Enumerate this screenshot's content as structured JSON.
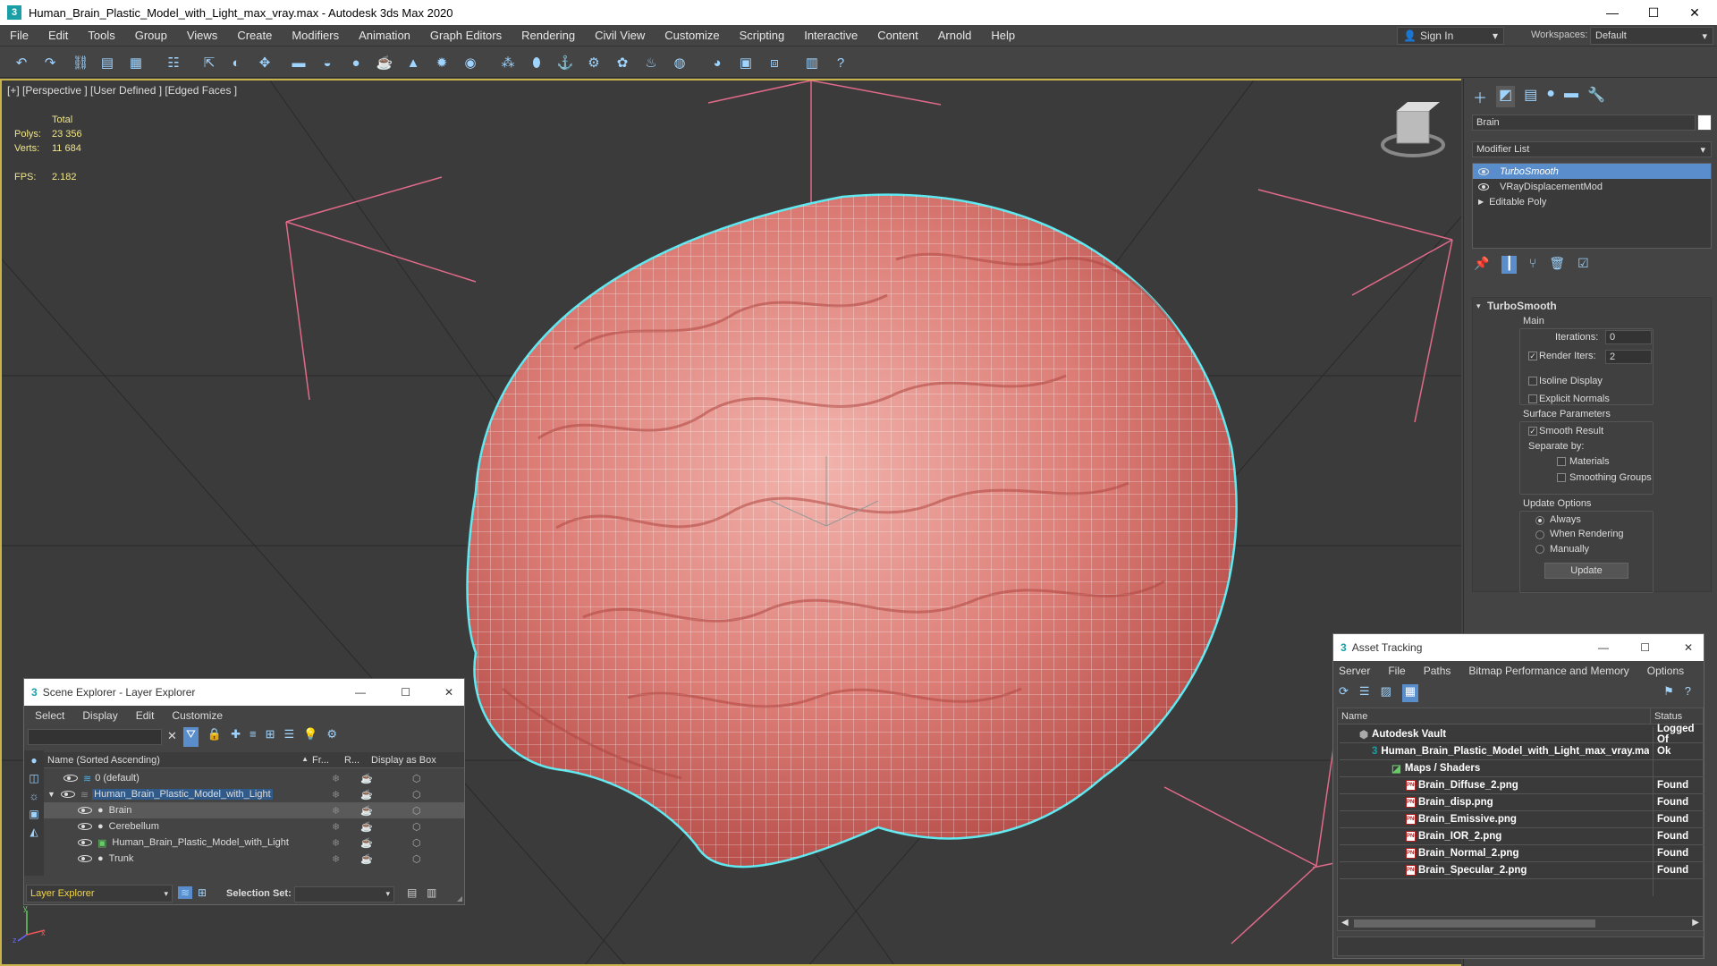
{
  "window": {
    "title": "Human_Brain_Plastic_Model_with_Light_max_vray.max - Autodesk 3ds Max 2020",
    "app_icon": "3",
    "minimize": "—",
    "maximize": "☐",
    "close": "✕"
  },
  "menu": [
    "File",
    "Edit",
    "Tools",
    "Group",
    "Views",
    "Create",
    "Modifiers",
    "Animation",
    "Graph Editors",
    "Rendering",
    "Civil View",
    "Customize",
    "Scripting",
    "Interactive",
    "Content",
    "Arnold",
    "Help"
  ],
  "signin": {
    "label": "Sign In",
    "arrow": "▾"
  },
  "workspaces": {
    "label": "Workspaces:",
    "value": "Default",
    "arrow": "▾"
  },
  "viewport": {
    "label": "[+] [Perspective ] [User Defined ] [Edged Faces ]",
    "stats": {
      "total": "Total",
      "polys_label": "Polys:",
      "polys": "23 356",
      "verts_label": "Verts:",
      "verts": "11 684",
      "fps_label": "FPS:",
      "fps": "2.182"
    },
    "axis": {
      "x": "x",
      "y": "y",
      "z": "z"
    }
  },
  "command_panel": {
    "object_name": "Brain",
    "modifier_list": "Modifier List",
    "modifier_list_arrow": "▾",
    "modifiers": [
      "TurboSmooth",
      "VRayDisplacementMod",
      "Editable Poly"
    ],
    "rollout": {
      "title": "TurboSmooth",
      "collapse": "▾",
      "main": "Main",
      "iterations_label": "Iterations:",
      "iterations": "0",
      "render_iters_label": "Render Iters:",
      "render_iters": "2",
      "isoline": "Isoline Display",
      "explicit_normals": "Explicit Normals",
      "surface_params": "Surface Parameters",
      "smooth_result": "Smooth Result",
      "separate_by": "Separate by:",
      "materials": "Materials",
      "smoothing_groups": "Smoothing Groups",
      "update_options": "Update Options",
      "always": "Always",
      "when_rendering": "When Rendering",
      "manually": "Manually",
      "update_button": "Update",
      "check": "✓"
    }
  },
  "scene_explorer": {
    "title": "Scene Explorer - Layer Explorer",
    "menu": [
      "Select",
      "Display",
      "Edit",
      "Customize"
    ],
    "columns": {
      "name": "Name (Sorted Ascending)",
      "sort_arrow": "▲",
      "freeze": "Fr...",
      "render": "R...",
      "box": "Display as Box"
    },
    "rows": [
      {
        "name": "0 (default)",
        "depth": 1,
        "selected": false
      },
      {
        "name": "Human_Brain_Plastic_Model_with_Light",
        "depth": 1,
        "selected": false,
        "highlight": true
      },
      {
        "name": "Brain",
        "depth": 2,
        "selected": true
      },
      {
        "name": "Cerebellum",
        "depth": 2,
        "selected": false
      },
      {
        "name": "Human_Brain_Plastic_Model_with_Light",
        "depth": 2,
        "selected": false
      },
      {
        "name": "Trunk",
        "depth": 2,
        "selected": false
      }
    ],
    "footer_layer": "Layer Explorer",
    "footer_arrow": "▾",
    "selection_set_label": "Selection Set:",
    "selection_set_arrow": "▾",
    "expand": "◢",
    "clear": "✕"
  },
  "asset_tracking": {
    "title": "Asset Tracking",
    "menu": [
      "Server",
      "File",
      "Paths",
      "Bitmap Performance and Memory",
      "Options"
    ],
    "columns": {
      "name": "Name",
      "status": "Status"
    },
    "rows": [
      {
        "name": "Autodesk Vault",
        "status": "Logged Of",
        "indent": 0
      },
      {
        "name": "Human_Brain_Plastic_Model_with_Light_max_vray.max",
        "status": "Ok",
        "indent": 1
      },
      {
        "name": "Maps / Shaders",
        "status": "",
        "indent": 2
      },
      {
        "name": "Brain_Diffuse_2.png",
        "status": "Found",
        "indent": 3
      },
      {
        "name": "Brain_disp.png",
        "status": "Found",
        "indent": 3
      },
      {
        "name": "Brain_Emissive.png",
        "status": "Found",
        "indent": 3
      },
      {
        "name": "Brain_IOR_2.png",
        "status": "Found",
        "indent": 3
      },
      {
        "name": "Brain_Normal_2.png",
        "status": "Found",
        "indent": 3
      },
      {
        "name": "Brain_Specular_2.png",
        "status": "Found",
        "indent": 3
      }
    ],
    "icons": {
      "max_file": "3",
      "png": "PNG",
      "scroll_left": "◀",
      "scroll_right": "▶"
    }
  },
  "colors": {
    "accent": "#5a8dcc",
    "viewport_border": "#c8b34a",
    "brain": "#d86a6a",
    "selection_outline": "#5ee8f0",
    "light_lines": "#e06a8a"
  }
}
